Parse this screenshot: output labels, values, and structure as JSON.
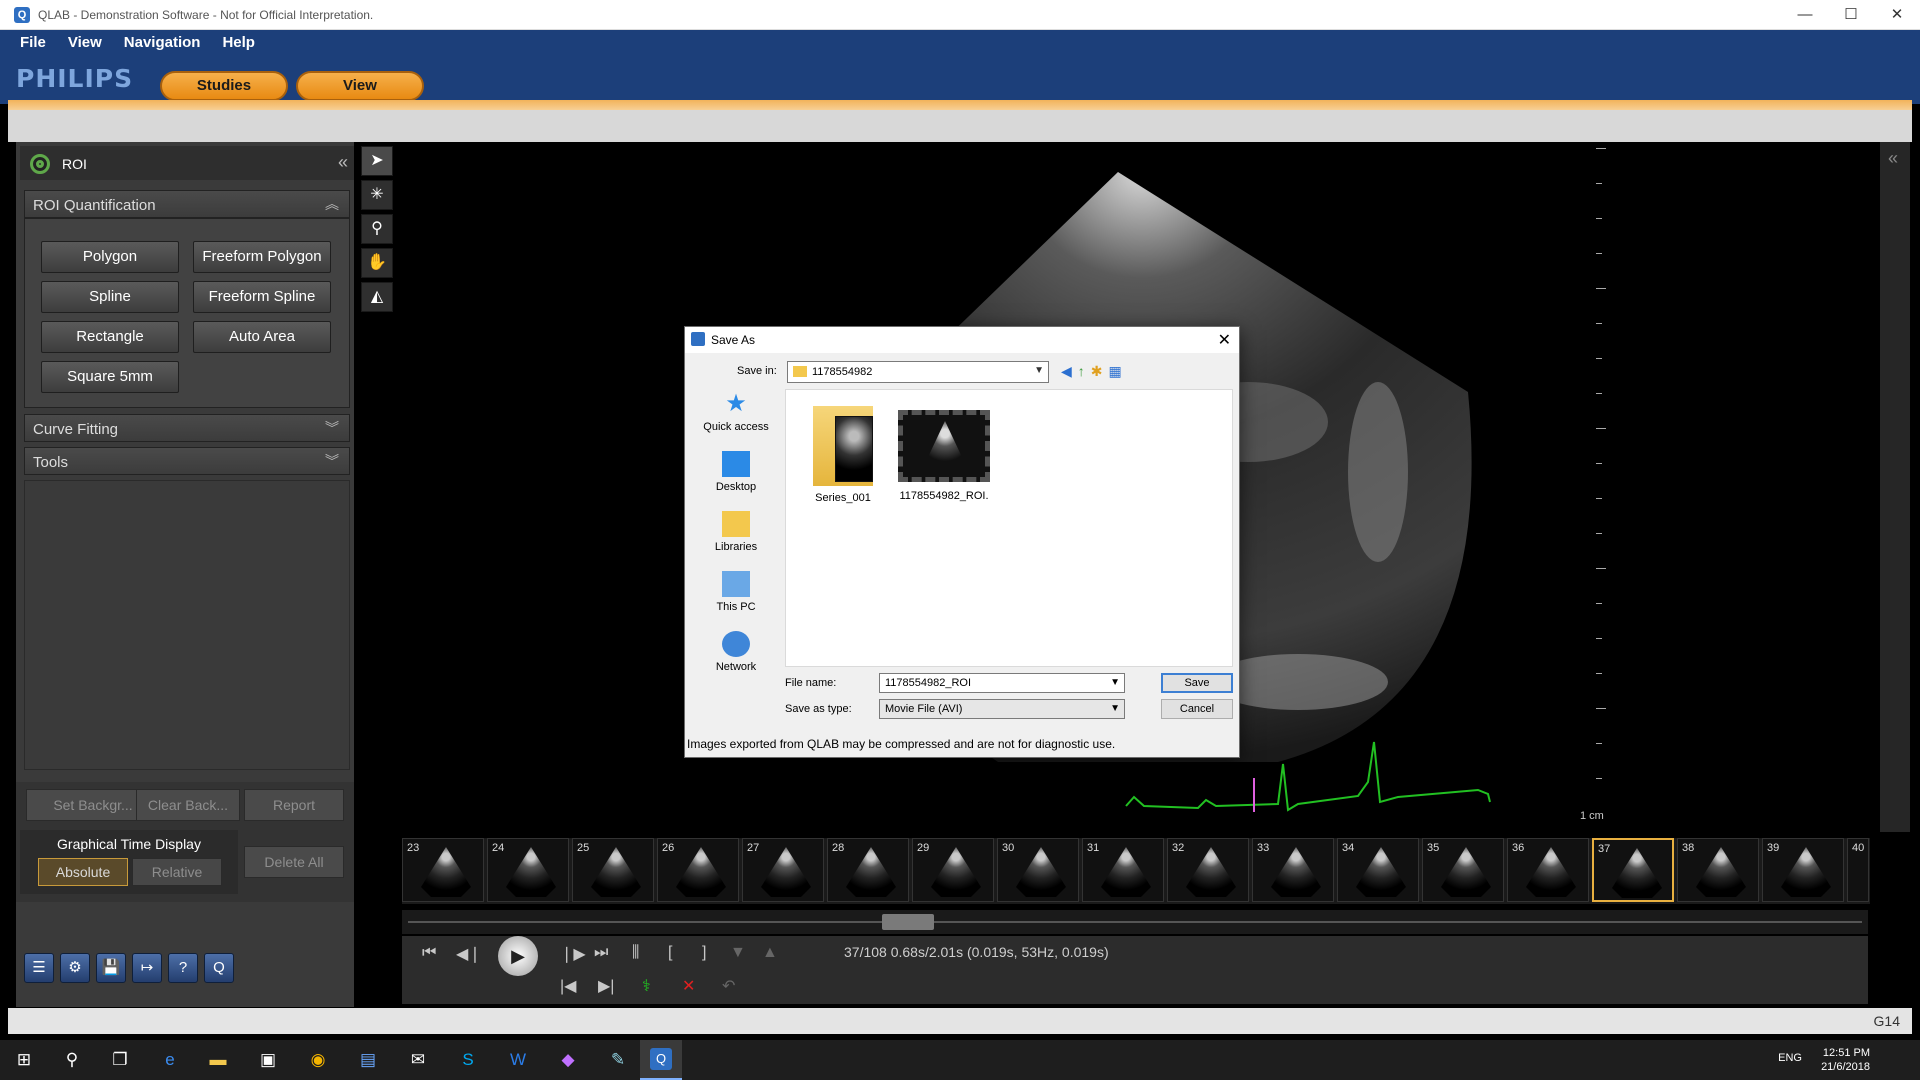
{
  "window": {
    "title": "QLAB - Demonstration Software - Not for Official Interpretation.",
    "minimize": "—",
    "maximize": "☐",
    "close": "✕"
  },
  "menu": {
    "items": [
      "File",
      "View",
      "Navigation",
      "Help"
    ]
  },
  "brand": "PHILIPS",
  "nav_tabs": [
    "Studies",
    "View"
  ],
  "left_panel": {
    "title": "ROI",
    "collapse": "«",
    "roi_quantification": {
      "label": "ROI Quantification",
      "buttons": [
        "Polygon",
        "Freeform Polygon",
        "Spline",
        "Freeform Spline",
        "Rectangle",
        "Auto Area",
        "Square 5mm"
      ]
    },
    "curve_fitting": "Curve Fitting",
    "tools": "Tools"
  },
  "lower_panel": {
    "set_background": "Set Backgr...",
    "clear_background": "Clear Back...",
    "report": "Report",
    "graphical_time_display": "Graphical Time Display",
    "absolute": "Absolute",
    "relative": "Relative",
    "delete_all": "Delete All"
  },
  "bottom_tools": [
    "☰",
    "⚙",
    "💾",
    "↦",
    "?",
    "Q"
  ],
  "vertical_tools": [
    "➤",
    "✳",
    "⚲",
    "✋",
    "◭"
  ],
  "viewer": {
    "scale_label": "1 cm",
    "expand": "«"
  },
  "thumbnails": {
    "frames": [
      "23",
      "24",
      "25",
      "26",
      "27",
      "28",
      "29",
      "30",
      "31",
      "32",
      "33",
      "34",
      "35",
      "36",
      "37",
      "38",
      "39",
      "40"
    ],
    "selected": "37"
  },
  "playback": {
    "frame_info": "37/108  0.68s/2.01s (0.019s, 53Hz, 0.019s)",
    "first": "⏮",
    "prev": "◀❘",
    "play": "▶",
    "next": "❘▶",
    "last": "⏭",
    "split": "⫼",
    "mark_in": "[",
    "mark_out": "]",
    "down": "▼",
    "up": "▲",
    "go_start": "|◀",
    "go_end": "▶|",
    "ecg": "⚕",
    "delete": "✕",
    "undo": "↶"
  },
  "status": {
    "label": "G14"
  },
  "dialog": {
    "title": "Save As",
    "save_in_label": "Save in:",
    "save_in_value": "1178554982",
    "places": [
      "Quick access",
      "Desktop",
      "Libraries",
      "This PC",
      "Network"
    ],
    "files": [
      "Series_001",
      "1178554982_ROI."
    ],
    "file_name_label": "File name:",
    "file_name_value": "1178554982_ROI",
    "save_as_type_label": "Save as type:",
    "save_as_type_value": "Movie File (AVI)",
    "save": "Save",
    "cancel": "Cancel",
    "note": "Images exported from QLAB may be compressed and are not for diagnostic use."
  },
  "taskbar": {
    "time": "12:51 PM",
    "date": "21/6/2018",
    "lang": "ENG"
  },
  "colors": {
    "accent_orange": "#e88a12",
    "menu_blue": "#1c3f7a",
    "ecg_green": "#22c022"
  }
}
